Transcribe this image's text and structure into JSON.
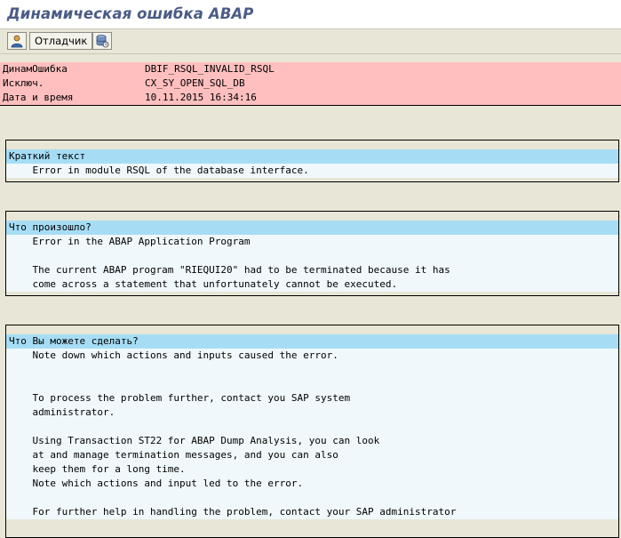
{
  "window": {
    "title": "Динамическая ошибка ABAP"
  },
  "toolbar": {
    "debugger_label": "Отладчик"
  },
  "header": {
    "rows": [
      {
        "key": "ДинамОшибка",
        "value": "DBIF_RSQL_INVALID_RSQL"
      },
      {
        "key": "Исключ.",
        "value": "CX_SY_OPEN_SQL_DB"
      },
      {
        "key": "Дата и время",
        "value": "10.11.2015 16:34:16"
      }
    ]
  },
  "sections": {
    "short_text": {
      "title": "Краткий текст",
      "lines": [
        "    Error in module RSQL of the database interface."
      ]
    },
    "what_happened": {
      "title": "Что произошло?",
      "lines": [
        "    Error in the ABAP Application Program",
        "",
        "    The current ABAP program \"RIEQUI20\" had to be terminated because it has",
        "    come across a statement that unfortunately cannot be executed."
      ]
    },
    "what_to_do": {
      "title": "Что Вы можете сделать?",
      "lines": [
        "    Note down which actions and inputs caused the error.",
        "",
        "",
        "    To process the problem further, contact you SAP system",
        "    administrator.",
        "",
        "    Using Transaction ST22 for ABAP Dump Analysis, you can look",
        "    at and manage termination messages, and you can also",
        "    keep them for a long time.",
        "    Note which actions and input led to the error.",
        "",
        "    For further help in handling the problem, contact your SAP administrator"
      ]
    }
  },
  "colors": {
    "header_row_bg": "#ffbfbf",
    "section_title_bg": "#a6ddf5",
    "section_line_bg": "#f0f8fb",
    "background": "#e8e6d6",
    "title_color": "#4a5c86"
  }
}
